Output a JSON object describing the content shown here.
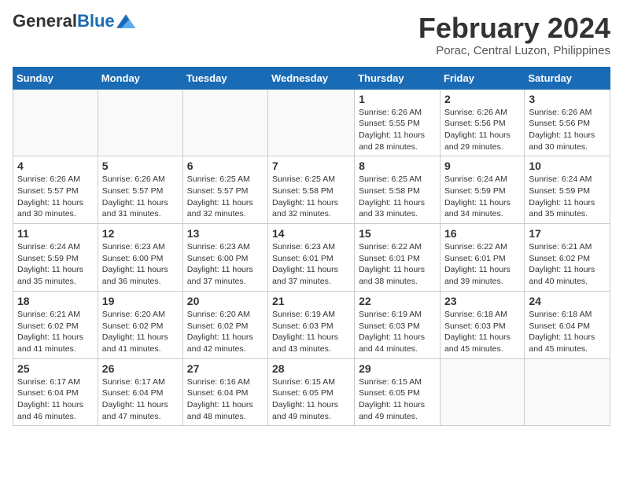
{
  "header": {
    "logo_general": "General",
    "logo_blue": "Blue",
    "month_year": "February 2024",
    "location": "Porac, Central Luzon, Philippines"
  },
  "days_of_week": [
    "Sunday",
    "Monday",
    "Tuesday",
    "Wednesday",
    "Thursday",
    "Friday",
    "Saturday"
  ],
  "weeks": [
    [
      {
        "day": "",
        "info": ""
      },
      {
        "day": "",
        "info": ""
      },
      {
        "day": "",
        "info": ""
      },
      {
        "day": "",
        "info": ""
      },
      {
        "day": "1",
        "info": "Sunrise: 6:26 AM\nSunset: 5:55 PM\nDaylight: 11 hours and 28 minutes."
      },
      {
        "day": "2",
        "info": "Sunrise: 6:26 AM\nSunset: 5:56 PM\nDaylight: 11 hours and 29 minutes."
      },
      {
        "day": "3",
        "info": "Sunrise: 6:26 AM\nSunset: 5:56 PM\nDaylight: 11 hours and 30 minutes."
      }
    ],
    [
      {
        "day": "4",
        "info": "Sunrise: 6:26 AM\nSunset: 5:57 PM\nDaylight: 11 hours and 30 minutes."
      },
      {
        "day": "5",
        "info": "Sunrise: 6:26 AM\nSunset: 5:57 PM\nDaylight: 11 hours and 31 minutes."
      },
      {
        "day": "6",
        "info": "Sunrise: 6:25 AM\nSunset: 5:57 PM\nDaylight: 11 hours and 32 minutes."
      },
      {
        "day": "7",
        "info": "Sunrise: 6:25 AM\nSunset: 5:58 PM\nDaylight: 11 hours and 32 minutes."
      },
      {
        "day": "8",
        "info": "Sunrise: 6:25 AM\nSunset: 5:58 PM\nDaylight: 11 hours and 33 minutes."
      },
      {
        "day": "9",
        "info": "Sunrise: 6:24 AM\nSunset: 5:59 PM\nDaylight: 11 hours and 34 minutes."
      },
      {
        "day": "10",
        "info": "Sunrise: 6:24 AM\nSunset: 5:59 PM\nDaylight: 11 hours and 35 minutes."
      }
    ],
    [
      {
        "day": "11",
        "info": "Sunrise: 6:24 AM\nSunset: 5:59 PM\nDaylight: 11 hours and 35 minutes."
      },
      {
        "day": "12",
        "info": "Sunrise: 6:23 AM\nSunset: 6:00 PM\nDaylight: 11 hours and 36 minutes."
      },
      {
        "day": "13",
        "info": "Sunrise: 6:23 AM\nSunset: 6:00 PM\nDaylight: 11 hours and 37 minutes."
      },
      {
        "day": "14",
        "info": "Sunrise: 6:23 AM\nSunset: 6:01 PM\nDaylight: 11 hours and 37 minutes."
      },
      {
        "day": "15",
        "info": "Sunrise: 6:22 AM\nSunset: 6:01 PM\nDaylight: 11 hours and 38 minutes."
      },
      {
        "day": "16",
        "info": "Sunrise: 6:22 AM\nSunset: 6:01 PM\nDaylight: 11 hours and 39 minutes."
      },
      {
        "day": "17",
        "info": "Sunrise: 6:21 AM\nSunset: 6:02 PM\nDaylight: 11 hours and 40 minutes."
      }
    ],
    [
      {
        "day": "18",
        "info": "Sunrise: 6:21 AM\nSunset: 6:02 PM\nDaylight: 11 hours and 41 minutes."
      },
      {
        "day": "19",
        "info": "Sunrise: 6:20 AM\nSunset: 6:02 PM\nDaylight: 11 hours and 41 minutes."
      },
      {
        "day": "20",
        "info": "Sunrise: 6:20 AM\nSunset: 6:02 PM\nDaylight: 11 hours and 42 minutes."
      },
      {
        "day": "21",
        "info": "Sunrise: 6:19 AM\nSunset: 6:03 PM\nDaylight: 11 hours and 43 minutes."
      },
      {
        "day": "22",
        "info": "Sunrise: 6:19 AM\nSunset: 6:03 PM\nDaylight: 11 hours and 44 minutes."
      },
      {
        "day": "23",
        "info": "Sunrise: 6:18 AM\nSunset: 6:03 PM\nDaylight: 11 hours and 45 minutes."
      },
      {
        "day": "24",
        "info": "Sunrise: 6:18 AM\nSunset: 6:04 PM\nDaylight: 11 hours and 45 minutes."
      }
    ],
    [
      {
        "day": "25",
        "info": "Sunrise: 6:17 AM\nSunset: 6:04 PM\nDaylight: 11 hours and 46 minutes."
      },
      {
        "day": "26",
        "info": "Sunrise: 6:17 AM\nSunset: 6:04 PM\nDaylight: 11 hours and 47 minutes."
      },
      {
        "day": "27",
        "info": "Sunrise: 6:16 AM\nSunset: 6:04 PM\nDaylight: 11 hours and 48 minutes."
      },
      {
        "day": "28",
        "info": "Sunrise: 6:15 AM\nSunset: 6:05 PM\nDaylight: 11 hours and 49 minutes."
      },
      {
        "day": "29",
        "info": "Sunrise: 6:15 AM\nSunset: 6:05 PM\nDaylight: 11 hours and 49 minutes."
      },
      {
        "day": "",
        "info": ""
      },
      {
        "day": "",
        "info": ""
      }
    ]
  ]
}
